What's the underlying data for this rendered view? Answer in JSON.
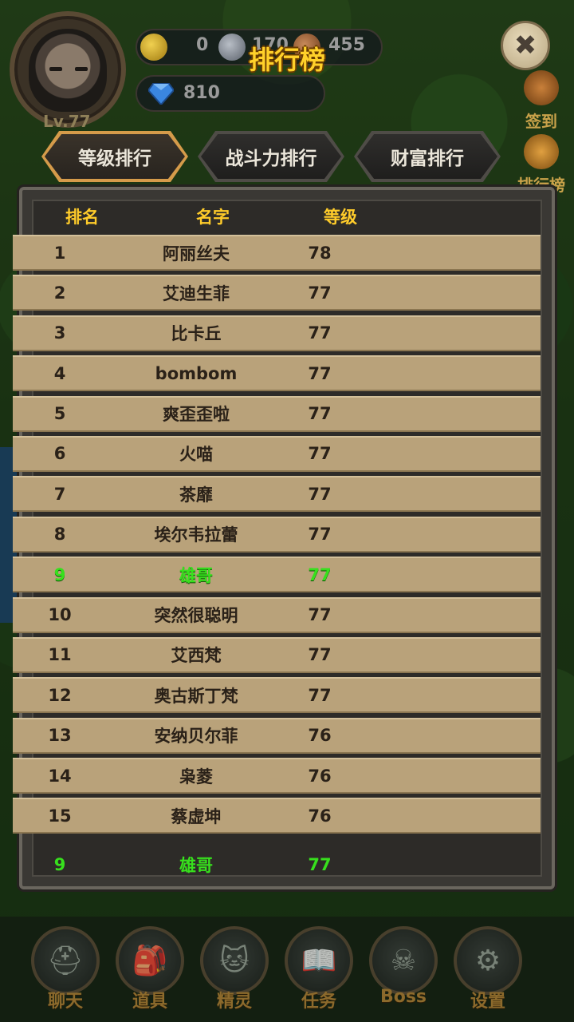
{
  "title": "排行榜",
  "player": {
    "level_text": "Lv.77",
    "gold": "0",
    "silver": "170",
    "bronze": "455",
    "gems": "810"
  },
  "side_buttons": [
    {
      "label": "签到",
      "icon": "calendar-icon"
    },
    {
      "label": "排行榜",
      "icon": "medal-icon"
    }
  ],
  "tabs": [
    {
      "label": "等级排行",
      "active": true
    },
    {
      "label": "战斗力排行",
      "active": false
    },
    {
      "label": "财富排行",
      "active": false
    }
  ],
  "table": {
    "headers": {
      "rank": "排名",
      "name": "名字",
      "level": "等级"
    },
    "rows": [
      {
        "rank": "1",
        "name": "阿丽丝夫",
        "level": "78"
      },
      {
        "rank": "2",
        "name": "艾迪生菲",
        "level": "77"
      },
      {
        "rank": "3",
        "name": "比卡丘",
        "level": "77"
      },
      {
        "rank": "4",
        "name": "bombom",
        "level": "77"
      },
      {
        "rank": "5",
        "name": "爽歪歪啦",
        "level": "77"
      },
      {
        "rank": "6",
        "name": "火喵",
        "level": "77"
      },
      {
        "rank": "7",
        "name": "茶靡",
        "level": "77"
      },
      {
        "rank": "8",
        "name": "埃尔韦拉蕾",
        "level": "77"
      },
      {
        "rank": "9",
        "name": "雄哥",
        "level": "77",
        "is_me": true
      },
      {
        "rank": "10",
        "name": "突然很聪明",
        "level": "77"
      },
      {
        "rank": "11",
        "name": "艾西梵",
        "level": "77"
      },
      {
        "rank": "12",
        "name": "奥古斯丁梵",
        "level": "77"
      },
      {
        "rank": "13",
        "name": "安纳贝尔菲",
        "level": "76"
      },
      {
        "rank": "14",
        "name": "枭菱",
        "level": "76"
      },
      {
        "rank": "15",
        "name": "蔡虚坤",
        "level": "76"
      }
    ],
    "my_rank": {
      "rank": "9",
      "name": "雄哥",
      "level": "77"
    }
  },
  "bottom_nav": [
    {
      "label": "聊天",
      "icon": "helmet-icon"
    },
    {
      "label": "道具",
      "icon": "backpack-icon"
    },
    {
      "label": "精灵",
      "icon": "cat-icon"
    },
    {
      "label": "任务",
      "icon": "book-icon"
    },
    {
      "label": "Boss",
      "icon": "skull-icon"
    },
    {
      "label": "设置",
      "icon": "gear-icon"
    }
  ],
  "colors": {
    "title": "#ffd12a",
    "header_text": "#ffcc2a",
    "highlight": "#37e01d",
    "row_bg": "#b9a27a",
    "active_tab_border": "#d59b4a"
  }
}
